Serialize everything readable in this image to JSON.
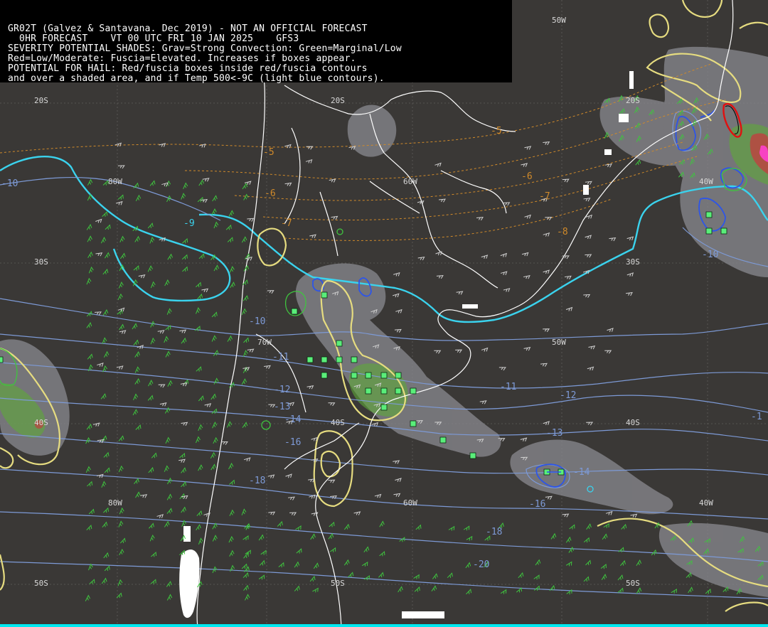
{
  "header": {
    "lines": [
      "GR02T (Galvez & Santavana. Dec 2019) - NOT AN OFFICIAL FORECAST",
      "  0HR FORECAST    VT 00 UTC FRI 10 JAN 2025    GFS3",
      "SEVERITY POTENTIAL SHADES: Grav=Strong Convection: Green=Marginal/Low",
      "Red=Low/Moderate: Fuscia=Elevated. Increases if boxes appear.",
      "POTENTIAL FOR HAIL: Red/fuscia boxes inside red/fuscia contours",
      "and over a shaded area, and if Temp 500<-9C (light blue contours)."
    ]
  },
  "grid_labels": {
    "lat": [
      {
        "text": "20S"
      },
      {
        "text": "20S"
      },
      {
        "text": "20S"
      },
      {
        "text": "30S"
      },
      {
        "text": "30S"
      },
      {
        "text": "40S"
      },
      {
        "text": "40S"
      },
      {
        "text": "40S"
      },
      {
        "text": "50S"
      },
      {
        "text": "50S"
      },
      {
        "text": "50S"
      }
    ],
    "lon": [
      {
        "text": "50W"
      },
      {
        "text": "80W"
      },
      {
        "text": "60W"
      },
      {
        "text": "40W"
      },
      {
        "text": "70W"
      },
      {
        "text": "50W"
      },
      {
        "text": "80W"
      },
      {
        "text": "60W"
      },
      {
        "text": "40W"
      }
    ]
  },
  "temp500_labels": [
    "-5",
    "-5",
    "-6",
    "-6",
    "-7",
    "-7",
    "-8",
    "-9",
    "-10",
    "-10",
    "-10",
    "-11",
    "-11",
    "-12",
    "-12",
    "-13",
    "-13",
    "-14",
    "-14",
    "-16",
    "-16",
    "-18",
    "-18",
    "-20",
    "-1"
  ],
  "colors": {
    "background": "#3a3836",
    "coast": "#ffffff",
    "temp500": "#7d9ad6",
    "cold_contour": "#3ad3ee",
    "severity_gray": "#8a8a90",
    "marginal_green": "#5ea838",
    "low_moderate_red": "#c02020",
    "elevated_fuscia": "#ff40d0",
    "yellow_contour": "#e6dc80",
    "hail_box": "#5aee7a",
    "wind_barb_green": "#3fc43f",
    "wind_barb_gray": "#cfcfcf"
  }
}
